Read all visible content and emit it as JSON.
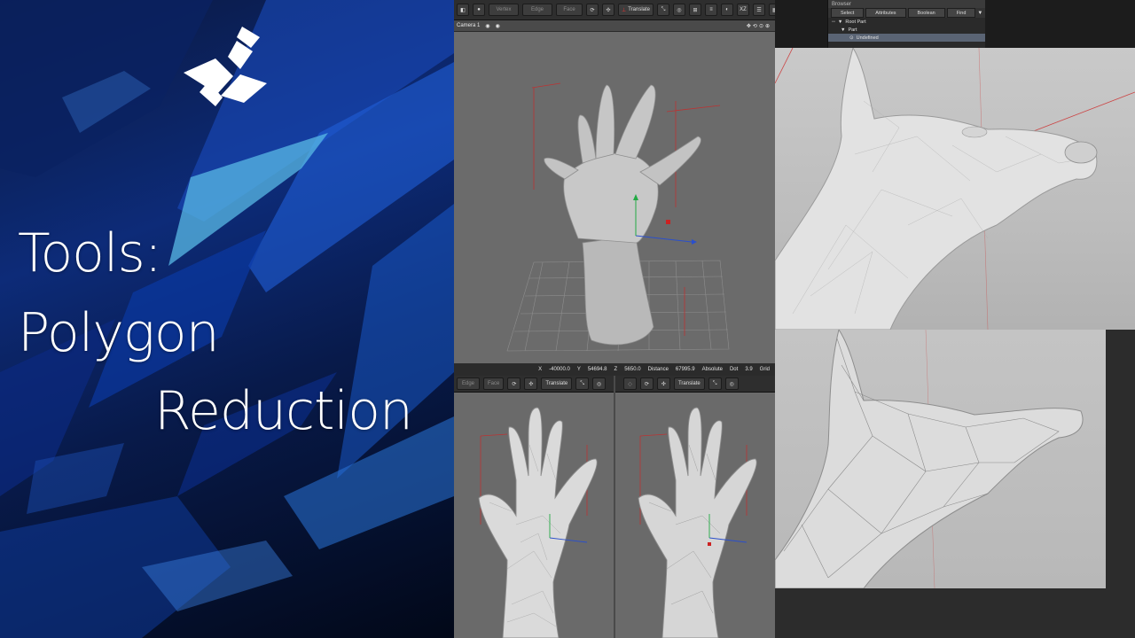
{
  "title": {
    "line1": "Tools:",
    "line2": "Polygon",
    "line3": "Reduction"
  },
  "toolbar_top": {
    "vertex": "Vertex",
    "edge": "Edge",
    "face": "Face",
    "translate": "Translate",
    "xz": "XZ"
  },
  "camera_bar": {
    "label": "Camera 1"
  },
  "browser": {
    "header": "Browser",
    "tabs": [
      "Select",
      "Attributes",
      "Boolean",
      "Find"
    ],
    "tree": [
      "Root Part",
      "Part",
      "Undefined"
    ]
  },
  "coord_bar": {
    "x_label": "X",
    "x_value": "-40000.0",
    "y_label": "Y",
    "y_value": "54694.8",
    "z_label": "Z",
    "z_value": "5650.0",
    "distance_label": "Distance",
    "distance_value": "67995.9",
    "mode": "Absolute",
    "dot_label": "Dot",
    "dot_value": "3.9",
    "grid_label": "Grid"
  },
  "toolbar_bottom": {
    "edge": "Edge",
    "face": "Face",
    "translate_left": "Translate",
    "translate_right": "Translate"
  },
  "colors": {
    "title_bg": "#0d2b78",
    "viewport_bg": "#6b6b6b",
    "axis_red": "#cc2222",
    "axis_blue": "#2a4fcc",
    "axis_green": "#22aa44"
  }
}
